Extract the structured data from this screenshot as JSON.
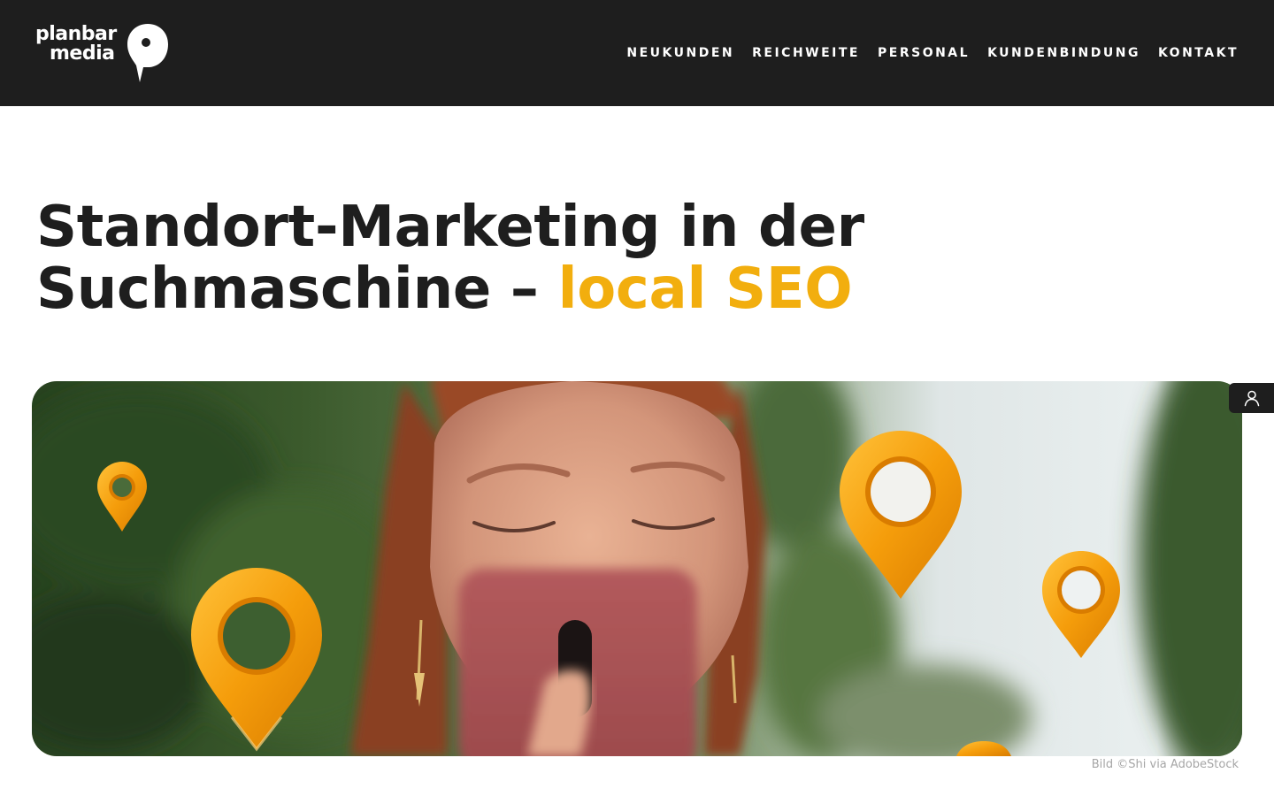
{
  "header": {
    "logo": {
      "line1": "planbar",
      "line2": "media"
    },
    "nav": [
      {
        "label": "NEUKUNDEN"
      },
      {
        "label": "REICHWEITE"
      },
      {
        "label": "PERSONAL"
      },
      {
        "label": "KUNDENBINDUNG"
      },
      {
        "label": "KONTAKT"
      }
    ]
  },
  "main": {
    "headline_part1": "Standort-Marketing in der",
    "headline_part2": "Suchmaschine – ",
    "headline_accent": "local SEO"
  },
  "hero": {
    "image_credit": "Bild ©Shi via AdobeStock",
    "icons": [
      "map-pin-icon"
    ]
  },
  "account_button": {
    "icon": "user-icon"
  },
  "colors": {
    "header_bg": "#1e1e1e",
    "accent": "#f2ae0e",
    "text": "#1e1e1e",
    "pin_orange": "#f59d0b",
    "credit_text": "#a6a6a6"
  }
}
